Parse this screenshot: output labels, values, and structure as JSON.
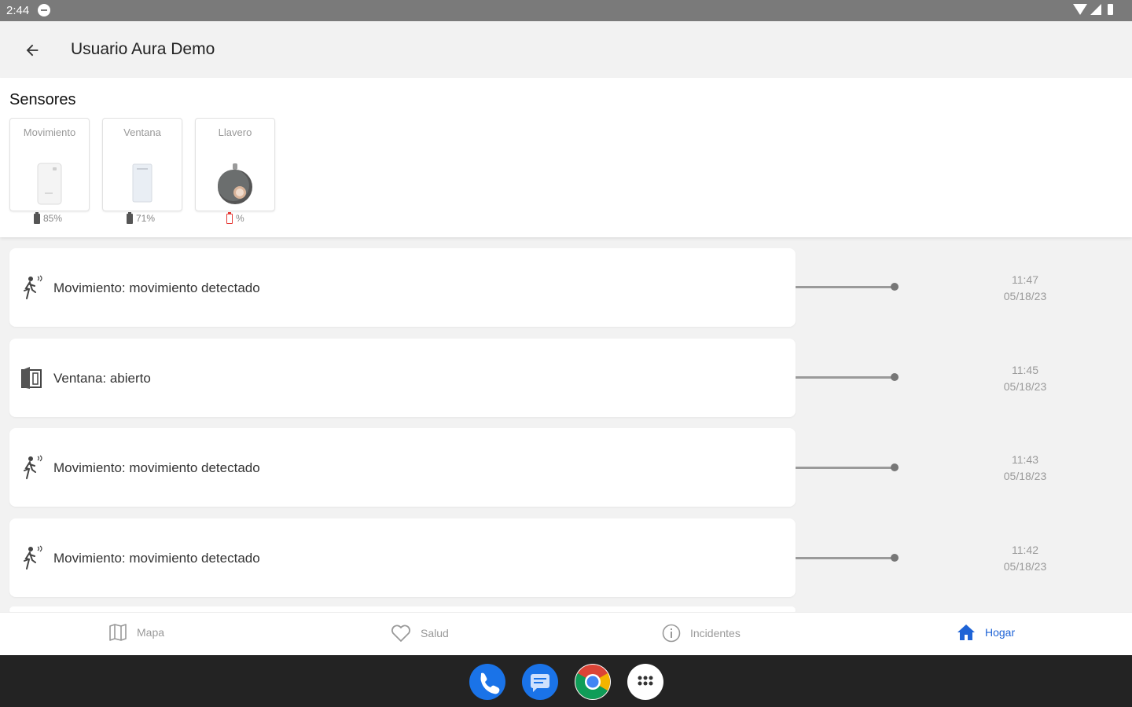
{
  "status_bar": {
    "time": "2:44"
  },
  "app_bar": {
    "title": "Usuario Aura Demo"
  },
  "sensors": {
    "heading": "Sensores",
    "items": [
      {
        "name": "Movimiento",
        "battery": "85%"
      },
      {
        "name": "Ventana",
        "battery": "71%"
      },
      {
        "name": "Llavero",
        "battery": "%"
      }
    ]
  },
  "events": [
    {
      "text": "Movimiento: movimiento detectado",
      "time": "11:47",
      "date": "05/18/23",
      "icon": "motion-icon"
    },
    {
      "text": "Ventana: abierto",
      "time": "11:45",
      "date": "05/18/23",
      "icon": "window-icon"
    },
    {
      "text": "Movimiento: movimiento detectado",
      "time": "11:43",
      "date": "05/18/23",
      "icon": "motion-icon"
    },
    {
      "text": "Movimiento: movimiento detectado",
      "time": "11:42",
      "date": "05/18/23",
      "icon": "motion-icon"
    }
  ],
  "bottom_nav": [
    {
      "label": "Mapa",
      "icon": "map-icon"
    },
    {
      "label": "Salud",
      "icon": "heart-icon"
    },
    {
      "label": "Incidentes",
      "icon": "info-icon"
    },
    {
      "label": "Hogar",
      "icon": "home-icon",
      "active": true
    }
  ],
  "colors": {
    "accent": "#1e63d6",
    "battery_low": "#e53935"
  }
}
